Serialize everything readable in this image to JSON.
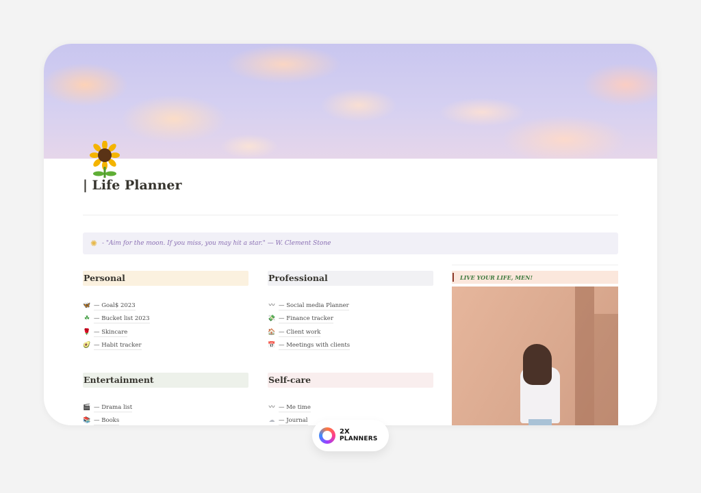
{
  "page": {
    "title": "| Life Planner",
    "cover_icon": "sunflower-icon"
  },
  "quote": {
    "icon": "sun-icon",
    "text": "- \"Aim for the moon. If you miss, you may hit a star.\" — W. Clement Stone"
  },
  "sections": {
    "personal": {
      "heading": "Personal",
      "items": [
        {
          "icon": "butterfly-icon",
          "glyph": "🦋",
          "label": "— Goal$ 2023"
        },
        {
          "icon": "clover-icon",
          "glyph": "☘",
          "label": "— Bucket list 2023"
        },
        {
          "icon": "rose-icon",
          "glyph": "🌹",
          "label": "— Skincare"
        },
        {
          "icon": "avocado-icon",
          "glyph": "🥑",
          "label": "— Habit tracker"
        }
      ]
    },
    "professional": {
      "heading": "Professional",
      "items": [
        {
          "icon": "wave-icon",
          "glyph": "〰",
          "label": "— Social media Planner"
        },
        {
          "icon": "money-icon",
          "glyph": "💸",
          "label": "— Finance tracker"
        },
        {
          "icon": "house-icon",
          "glyph": "🏠",
          "label": "— Client work"
        },
        {
          "icon": "calendar-icon",
          "glyph": "📅",
          "label": "— Meetings with clients"
        }
      ]
    },
    "entertainment": {
      "heading": "Entertainment",
      "items": [
        {
          "icon": "clapper-icon",
          "glyph": "🎬",
          "label": "— Drama list"
        },
        {
          "icon": "books-icon",
          "glyph": "📚",
          "label": "— Books"
        }
      ]
    },
    "selfcare": {
      "heading": "Self-care",
      "items": [
        {
          "icon": "wave-icon",
          "glyph": "〰",
          "label": "— Me time"
        },
        {
          "icon": "cloud-icon",
          "glyph": "☁",
          "label": "— Journal"
        }
      ]
    }
  },
  "banner": {
    "text": "LIVE YOUR LIFE, MEN!"
  },
  "brand": {
    "line1": "2X",
    "line2": "PLANNERS"
  }
}
